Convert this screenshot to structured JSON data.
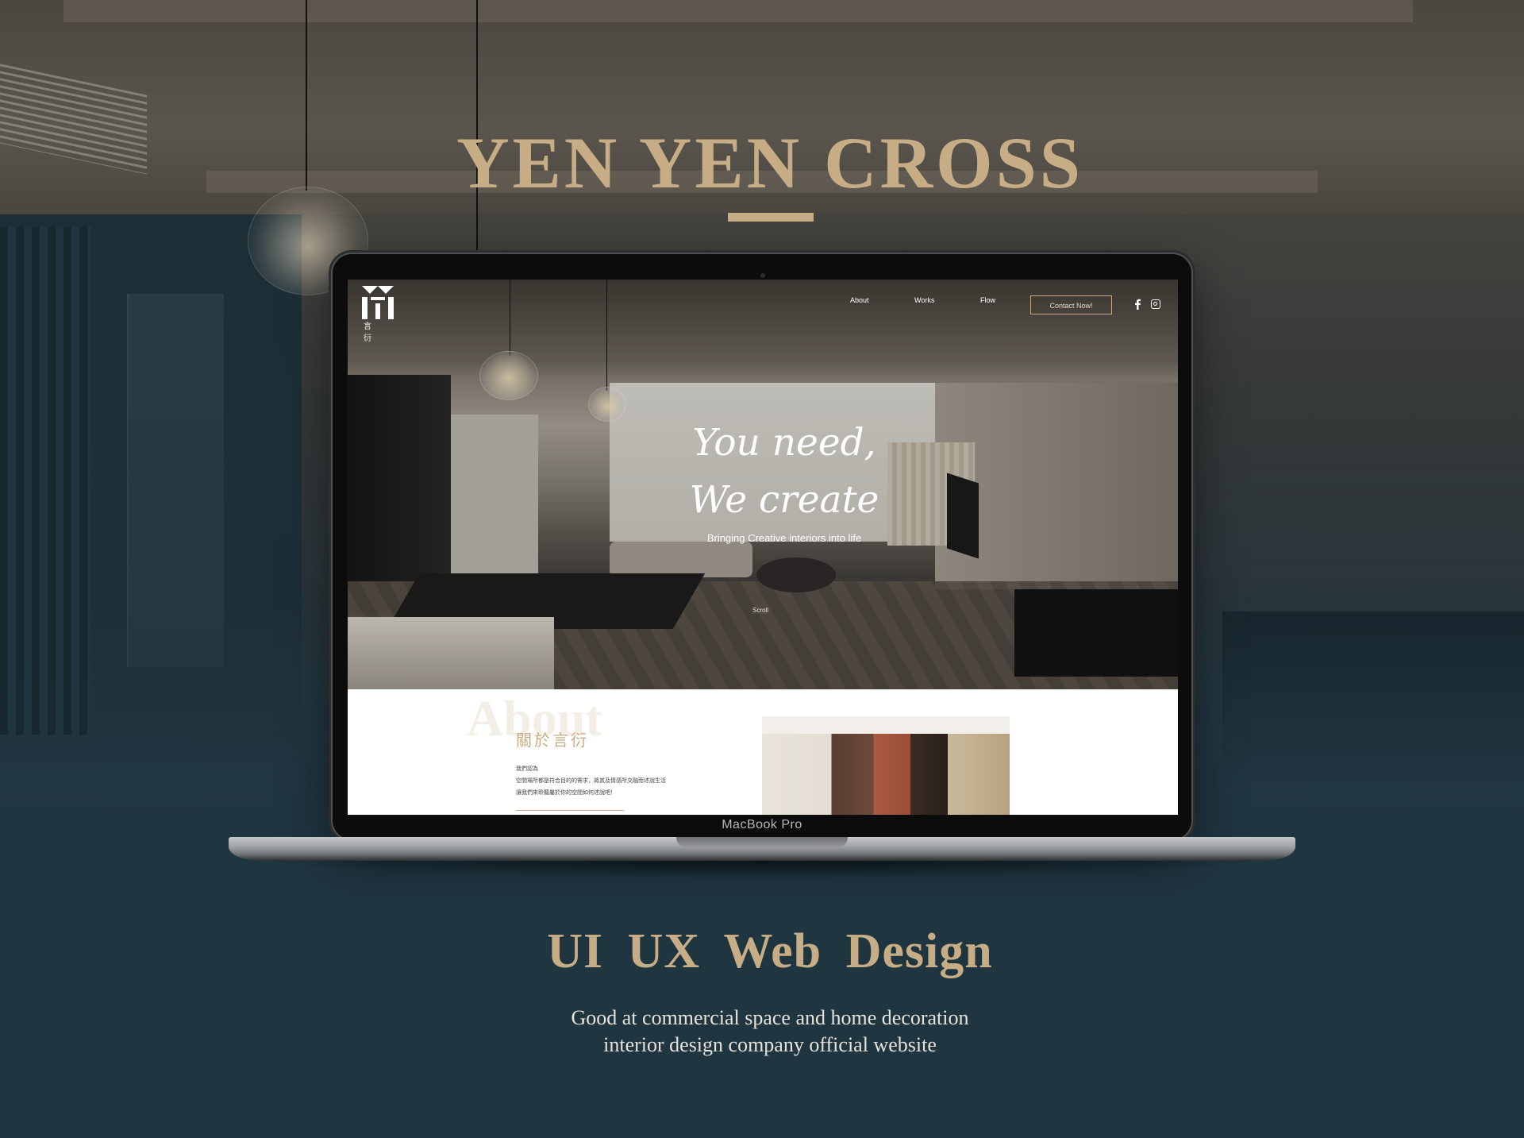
{
  "headline": {
    "title": "YEN YEN CROSS"
  },
  "device": {
    "label": "MacBook Pro"
  },
  "website": {
    "logo": {
      "caption": "言 衍"
    },
    "nav": {
      "items": [
        "About",
        "Works",
        "Flow"
      ],
      "contact_label": "Contact Now!"
    },
    "social": [
      "facebook-icon",
      "instagram-icon"
    ],
    "hero": {
      "tagline_line1": "You need,",
      "tagline_line2": "We create",
      "subline": "Bringing Creative interiors into life",
      "scroll": "Scroll"
    },
    "about": {
      "bg_word": "About",
      "title": "關於言衍",
      "text_line1": "我們認為",
      "text_line2": "空間場所都是符合目的的需求，將其及情感所交融而述說生活",
      "text_line3": "讓我們來聆聽屬於你的空間如何述說吧！"
    }
  },
  "footer": {
    "heading": "UI  UX  Web Design",
    "desc_line1": "Good at commercial space and home decoration",
    "desc_line2": "interior design company official website"
  },
  "colors": {
    "accent_gold": "#c7ad85",
    "background_teal": "#1f3540",
    "text_light": "#e6e2dc"
  }
}
